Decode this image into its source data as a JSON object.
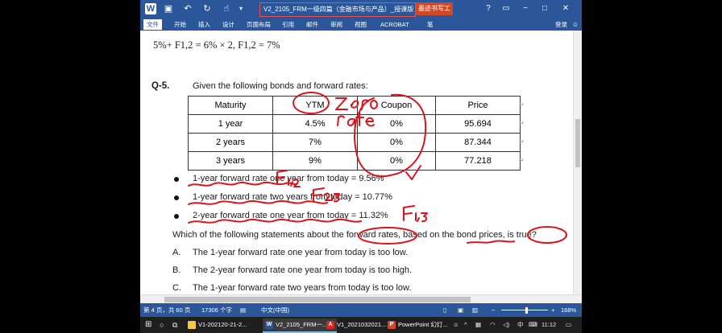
{
  "window": {
    "title": "V2_2105_FRM一级四篇（金融市场与产品）_授课版 - Micro...",
    "context_tab": "墨迹书写工具",
    "help": "?",
    "minimize": "−",
    "restore": "□",
    "close": "✕"
  },
  "ribbon": {
    "tabs": [
      "文件",
      "开始",
      "插入",
      "设计",
      "页面布局",
      "引用",
      "邮件",
      "审阅",
      "视图",
      "ACROBAT",
      "笔"
    ],
    "login": "登录"
  },
  "document": {
    "formula_line": "5%+ F1,2 = 6% × 2,  F1,2 = 7%",
    "question_number": "Q-5.",
    "question_intro": "Given the following bonds and forward rates:",
    "table": {
      "headers": [
        "Maturity",
        "YTM",
        "Coupon",
        "Price"
      ],
      "rows": [
        [
          "1 year",
          "4.5%",
          "0%",
          "95.694"
        ],
        [
          "2 years",
          "7%",
          "0%",
          "87.344"
        ],
        [
          "3 years",
          "9%",
          "0%",
          "77.218"
        ]
      ]
    },
    "bullets": [
      "1-year forward rate one year from today = 9.56%",
      "1-year forward rate two years from today = 10.77%",
      "2-year forward rate one year from today = 11.32%"
    ],
    "statement": "Which of the following statements about the forward rates, based on the bond prices, is true?",
    "options": [
      {
        "letter": "A.",
        "text": "The 1-year forward rate one year from today is too low."
      },
      {
        "letter": "B.",
        "text": "The 2-year forward rate one year from today is too high."
      },
      {
        "letter": "C.",
        "text": "The 1-year forward rate two years from today is too low."
      }
    ],
    "ink_annotations": [
      "zero",
      "rate",
      "F1,2",
      "F2,3",
      "F1,3"
    ]
  },
  "statusbar": {
    "page": "第 4 页，共 60 页",
    "words": "17306 个字",
    "language": "中文(中国)",
    "zoom": "168%"
  },
  "taskbar": {
    "items": [
      {
        "label": "V1-202120-21-2...",
        "icon": "folder-icon",
        "color": "#f2c744"
      },
      {
        "label": "V2_2105_FRM一...",
        "icon": "word-icon",
        "color": "#2b579a"
      },
      {
        "label": "V1_2021032021...",
        "icon": "pdf-icon",
        "color": "#d9261c"
      },
      {
        "label": "PowerPoint 幻灯...",
        "icon": "powerpoint-icon",
        "color": "#d24726"
      }
    ],
    "ime": "中",
    "time": "11:12"
  }
}
